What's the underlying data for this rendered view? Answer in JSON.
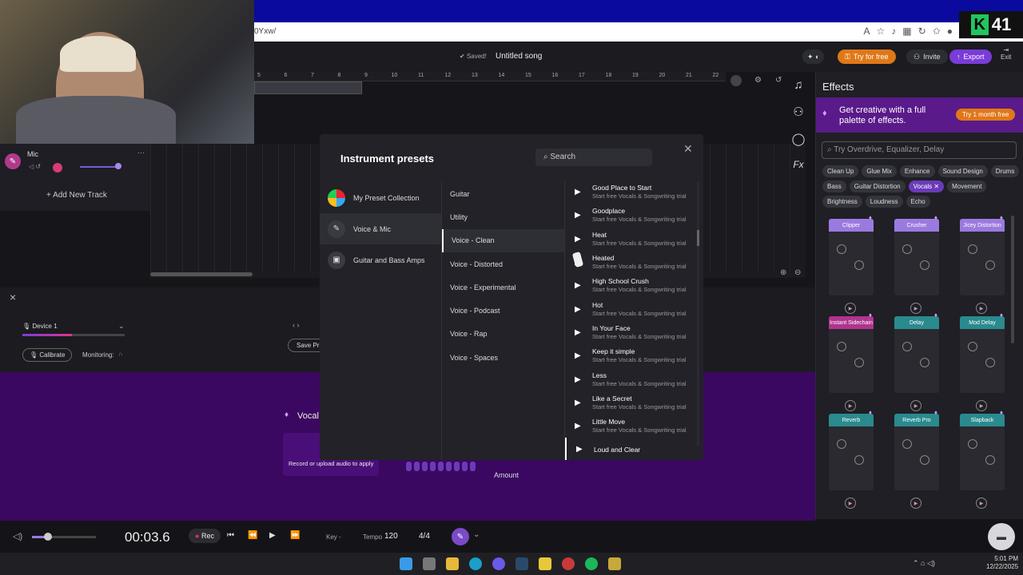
{
  "browser": {
    "url_fragment": "0Yxw/"
  },
  "overlay": {
    "brand_letter": "K",
    "number": "41"
  },
  "header": {
    "saved_label": "Saved!",
    "song_title": "Untitled song",
    "try_label": "Try for free",
    "invite_label": "Invite",
    "export_label": "Export",
    "exit_label": "Exit"
  },
  "ruler": {
    "ticks": [
      "5",
      "6",
      "7",
      "8",
      "9",
      "10",
      "11",
      "12",
      "13",
      "14",
      "15",
      "16",
      "17",
      "18",
      "19",
      "20",
      "21",
      "22"
    ]
  },
  "track": {
    "name": "Mic",
    "add_label": "Add New Track"
  },
  "effects": {
    "title": "Effects",
    "promo_text": "Get creative with a full palette of effects.",
    "promo_button": "Try 1 month free",
    "search_placeholder": "Try Overdrive, Equalizer, Delay",
    "tags": [
      "Clean Up",
      "Glue Mix",
      "Enhance",
      "Sound Design",
      "Drums",
      "Bass",
      "Guitar Distortion",
      "Vocals",
      "Movement",
      "Brightness",
      "Loudness",
      "Echo"
    ],
    "active_tag": "Vocals",
    "cards": [
      {
        "name": "Clipper",
        "color": "#9b7ae0"
      },
      {
        "name": "Crusher",
        "color": "#9b7ae0"
      },
      {
        "name": "Jicey Distortion",
        "color": "#9b7ae0"
      },
      {
        "name": "Instant Sidechain",
        "color": "#b0348e"
      },
      {
        "name": "Delay",
        "color": "#2a8a8e"
      },
      {
        "name": "Mod Delay",
        "color": "#2a8a8e"
      },
      {
        "name": "Reverb",
        "color": "#2a8a8e"
      },
      {
        "name": "Reverb Pro",
        "color": "#2a8a8e"
      },
      {
        "name": "Slapback",
        "color": "#2a8a8e"
      }
    ]
  },
  "lower": {
    "device": "Device 1",
    "calibrate": "Calibrate",
    "monitoring": "Monitoring:",
    "save_preset": "Save Pre"
  },
  "vocal": {
    "title": "Vocal",
    "hint": "Record or upload audio to apply",
    "amount_label": "Amount"
  },
  "modal": {
    "title": "Instrument presets",
    "search_placeholder": "Search",
    "categories": [
      {
        "label": "My Preset Collection",
        "icon": "color-wheel-icon"
      },
      {
        "label": "Voice & Mic",
        "icon": "mic-icon"
      },
      {
        "label": "Guitar and Bass Amps",
        "icon": "amp-icon"
      }
    ],
    "subcategories": [
      "Guitar",
      "Utility",
      "Voice - Clean",
      "Voice - Distorted",
      "Voice - Experimental",
      "Voice - Podcast",
      "Voice - Rap",
      "Voice - Spaces"
    ],
    "active_subcategory": "Voice - Clean",
    "presets": [
      {
        "name": "Good Place to Start",
        "sub": "Start free Vocals & Songwriting trial"
      },
      {
        "name": "Goodplace",
        "sub": "Start free Vocals & Songwriting trial"
      },
      {
        "name": "Heat",
        "sub": "Start free Vocals & Songwriting trial"
      },
      {
        "name": "Heated",
        "sub": "Start free Vocals & Songwriting trial"
      },
      {
        "name": "High School Crush",
        "sub": "Start free Vocals & Songwriting trial"
      },
      {
        "name": "Hot",
        "sub": "Start free Vocals & Songwriting trial"
      },
      {
        "name": "In Your Face",
        "sub": "Start free Vocals & Songwriting trial"
      },
      {
        "name": "Keep it simple",
        "sub": "Start free Vocals & Songwriting trial"
      },
      {
        "name": "Less",
        "sub": "Start free Vocals & Songwriting trial"
      },
      {
        "name": "Like a Secret",
        "sub": "Start free Vocals & Songwriting trial"
      },
      {
        "name": "Little Move",
        "sub": "Start free Vocals & Songwriting trial"
      },
      {
        "name": "Loud and Clear",
        "sub": ""
      }
    ]
  },
  "transport": {
    "time": "00:03.6",
    "rec_label": "Rec",
    "key_label": "Key",
    "key_value": "-",
    "tempo_label": "Tempo",
    "tempo_value": "120",
    "signature": "4/4"
  },
  "taskbar": {
    "time": "5:01 PM",
    "date": "12/22/2025"
  }
}
